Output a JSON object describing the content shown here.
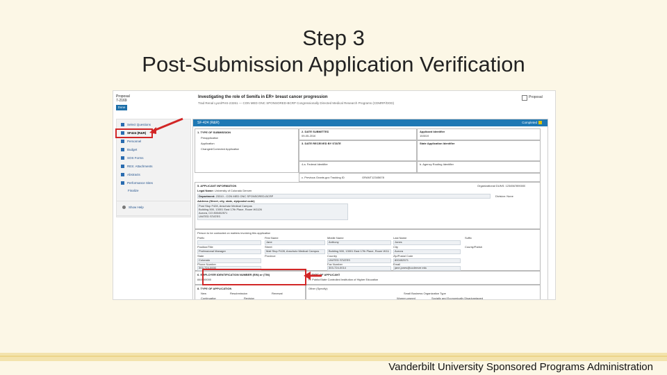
{
  "slide": {
    "title_line1": "Step 3",
    "title_line2": "Post-Submission Application Verification",
    "footer": "Vanderbilt University Sponsored Programs Administration"
  },
  "screenshot": {
    "header": {
      "proposal_label": "Proposal",
      "proposal_number": "7-2169",
      "done_label": "Done",
      "doc_title": "Investigating the role of Semifa in ER+ breast cancer progression",
      "doc_subtitle": "Trad Renal Lyon/PHS-23261 — CON MED ONC SPONSORED-BCRP Congressionally Directed Medical Research Programs (CDMRP/DOD)",
      "proposal_check_label": "Proposal"
    },
    "sidebar": {
      "items": [
        {
          "label": "Select Questions"
        },
        {
          "label": "SF424 (R&R)"
        },
        {
          "label": "Personnel"
        },
        {
          "label": "Budget"
        },
        {
          "label": "SOS Forms"
        },
        {
          "label": "RES: Attachments"
        },
        {
          "label": "Abstracts"
        },
        {
          "label": "Performance Sites"
        }
      ],
      "finalize": "Finalize",
      "help": "Show Help"
    },
    "form": {
      "bar_label": "SF-424 (R&R)",
      "bar_status": "Completed",
      "type_submission": "1. TYPE OF SUBMISSION",
      "submission_options": [
        "Preapplication",
        "Application",
        "Changed/Corrected Application"
      ],
      "date_submitted": "2. DATE SUBMITTED",
      "date_submitted_val": "09-05-2016",
      "applicant_id": "Applicant Identifier",
      "applicant_id_val": "153019",
      "date_received": "3. DATE RECEIVED BY STATE",
      "state_app_id": "State Application Identifier",
      "fed_id": "4.a. Federal Identifier",
      "agency_routing": "b. Agency Routing Identifier",
      "prev_grants": "c. Previous Grants.gov Tracking ID",
      "prev_grants_val": "GRANT12345678",
      "applicant_info": "5. APPLICANT INFORMATION",
      "org_duns": "Organizational DUNS:",
      "org_duns_val": "1234567890000",
      "legal_name": "Legal Name:",
      "legal_name_val": "University of Colorado Denver",
      "department": "Department:",
      "department_val": "23310 - CON MED ONC SPONSORED-BCRP",
      "division": "Division:",
      "division_val": "None",
      "address_label": "Address (Street, city, state, zip/postal code)",
      "address_lines": [
        "Post Stop F428, Anschutz Medical Campus",
        "Building 500, 13001 East 17th Place, Room W1126",
        "Aurora, CO 800452571",
        "UNITED STATES"
      ],
      "contact_person": "Person to be contacted on matters involving this application",
      "contact_headers": [
        "Prefix",
        "First Name",
        "Middle Name",
        "Last Name",
        "Suffix"
      ],
      "contact_values": [
        "",
        "Jane",
        "Anthony",
        "Jones",
        ""
      ],
      "addr_headers": [
        "Position/Title",
        "Street",
        "City",
        "County/Parish"
      ],
      "addr_values": [
        "Professional Manager",
        "Mail Stop F428, Anschutz Medical Campus",
        "Building 500, 13001 East 17th Place, Room W1126",
        "Aurora"
      ],
      "state_headers": [
        "State",
        "Province",
        "Country",
        "Zip/Postal Code"
      ],
      "state_values": [
        "Colorado",
        "",
        "UNITED STATES",
        "800452571"
      ],
      "phone_headers": [
        "Phone Number",
        "Fax Number",
        "Email"
      ],
      "phone_values": [
        "303-724-0000",
        "303-724-0014",
        "jane.jones@ucdenver.edu"
      ],
      "employer_id": "6. EMPLOYER IDENTIFICATION NUMBER (EIN) or (TIN)",
      "employer_id_val": "840000000",
      "type_applicant": "7. TYPE OF APPLICANT",
      "type_applicant_val": "H: Public/State Controlled Institution of Higher Education",
      "other_specify": "Other (Specify):",
      "type_application": "8. TYPE OF APPLICATION",
      "application_options": [
        "New",
        "Resubmission",
        "Renewal",
        "Continuation",
        "Revision"
      ],
      "small_business": "Small Business Organization Type",
      "small_business_options": [
        "Women-owned",
        "Socially and Economically Disadvantaged"
      ]
    }
  }
}
